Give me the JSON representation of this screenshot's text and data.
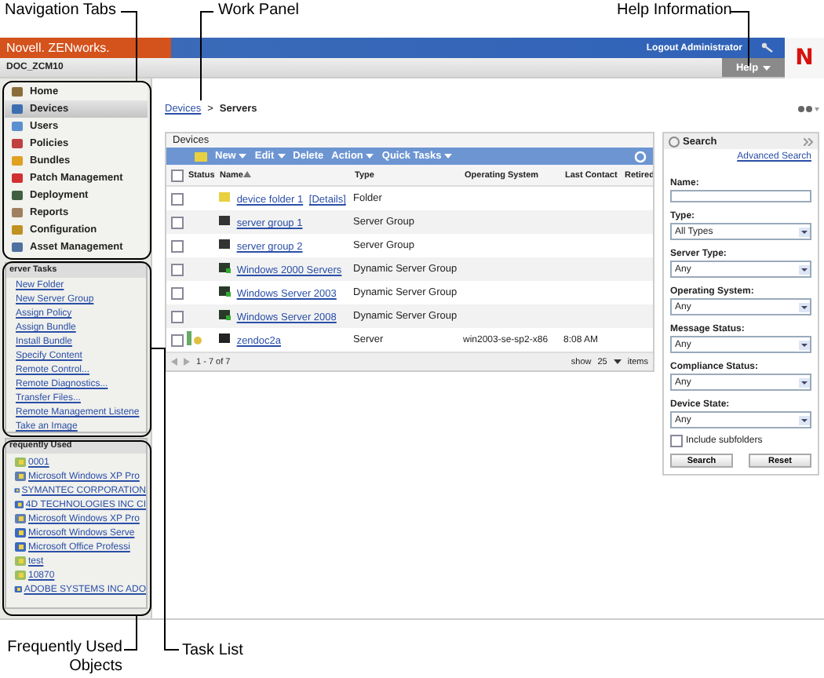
{
  "callouts": [
    {
      "text": "Navigation Tabs"
    },
    {
      "text": "Work Panel"
    },
    {
      "text": "Help Information"
    },
    {
      "text": "Frequently Used Objects"
    },
    {
      "text": "Task List"
    }
  ],
  "header": {
    "brand": "Novell. ZENworks.",
    "logout": "Logout Administrator",
    "zone": "DOC_ZCM10",
    "help": "Help",
    "logo": "N"
  },
  "nav": {
    "items": [
      {
        "label": "Home",
        "selected": false
      },
      {
        "label": "Devices",
        "selected": true
      },
      {
        "label": "Users",
        "selected": false
      },
      {
        "label": "Policies",
        "selected": false
      },
      {
        "label": "Bundles",
        "selected": false
      },
      {
        "label": "Patch Management",
        "selected": false
      },
      {
        "label": "Deployment",
        "selected": false
      },
      {
        "label": "Reports",
        "selected": false
      },
      {
        "label": "Configuration",
        "selected": false
      },
      {
        "label": "Asset Management",
        "selected": false
      }
    ]
  },
  "tasks": {
    "title": "erver Tasks",
    "items": [
      "New Folder",
      "New Server Group",
      "Assign Policy",
      "Assign Bundle",
      "Install Bundle",
      "Specify Content",
      "Remote Control...",
      "Remote Diagnostics...",
      "Transfer Files...",
      "Remote Management Listene",
      "Take an Image"
    ]
  },
  "frequent": {
    "title": "requently Used",
    "items": [
      {
        "label": "0001",
        "kind": "bundle"
      },
      {
        "label": "Microsoft Windows XP Pro",
        "kind": "computer"
      },
      {
        "label": "SYMANTEC CORPORATION",
        "kind": "package"
      },
      {
        "label": "4D TECHNOLOGIES INC CI",
        "kind": "package"
      },
      {
        "label": "Microsoft Windows XP Pro",
        "kind": "computer"
      },
      {
        "label": "Microsoft Windows Serve",
        "kind": "package"
      },
      {
        "label": "Microsoft Office Professi",
        "kind": "package"
      },
      {
        "label": "test",
        "kind": "bundle"
      },
      {
        "label": "10870",
        "kind": "bundle"
      },
      {
        "label": "ADOBE SYSTEMS INC ADO",
        "kind": "package"
      }
    ]
  },
  "breadcrumb": {
    "link": "Devices",
    "separator": ">",
    "current": "Servers"
  },
  "devices": {
    "title": "Devices",
    "toolbar": [
      {
        "label": "New",
        "menu": true
      },
      {
        "label": "Edit",
        "menu": true
      },
      {
        "label": "Delete",
        "menu": false
      },
      {
        "label": "Action",
        "menu": true
      },
      {
        "label": "Quick Tasks",
        "menu": true
      }
    ],
    "select_all": {
      "checked": false
    },
    "columns": [
      "Status",
      "Name",
      "Type",
      "Operating System",
      "Last Contact",
      "Retired"
    ],
    "rows": [
      {
        "name": "device folder 1",
        "details": "[Details]",
        "type": "Folder",
        "os": "",
        "last_contact": "",
        "kind": "folder",
        "has_status": false,
        "checked": false
      },
      {
        "name": "server group 1",
        "type": "Server Group",
        "kind": "group",
        "has_status": false,
        "checked": false
      },
      {
        "name": "server group 2",
        "type": "Server Group",
        "kind": "group",
        "has_status": false,
        "checked": false
      },
      {
        "name": "Windows 2000 Servers",
        "type": "Dynamic Server Group",
        "kind": "dynamic",
        "has_status": false,
        "checked": false
      },
      {
        "name": "Windows Server 2003",
        "type": "Dynamic Server Group",
        "kind": "dynamic",
        "has_status": false,
        "checked": false
      },
      {
        "name": "Windows Server 2008",
        "type": "Dynamic Server Group",
        "kind": "dynamic",
        "has_status": false,
        "checked": false
      },
      {
        "name": "zendoc2a",
        "type": "Server",
        "os": "win2003-se-sp2-x86",
        "last_contact": "8:08 AM",
        "kind": "server",
        "has_status": true,
        "checked": false
      }
    ],
    "footer": {
      "range": "1 - 7 of 7",
      "show": "show",
      "count": "25",
      "items": "items"
    }
  },
  "search": {
    "title": "Search",
    "advanced": "Advanced Search",
    "fields": [
      {
        "label": "Name:",
        "kind": "text"
      },
      {
        "label": "Type:",
        "kind": "select",
        "value": "All Types"
      },
      {
        "label": "Server Type:",
        "kind": "select",
        "value": "Any"
      },
      {
        "label": "Operating System:",
        "kind": "select",
        "value": "Any"
      },
      {
        "label": "Message Status:",
        "kind": "select",
        "value": "Any"
      },
      {
        "label": "Compliance Status:",
        "kind": "select",
        "value": "Any"
      },
      {
        "label": "Device State:",
        "kind": "select",
        "value": "Any"
      }
    ],
    "subfolders": {
      "label": "Include subfolders",
      "checked": false
    },
    "buttons": [
      "Search",
      "Reset"
    ]
  }
}
